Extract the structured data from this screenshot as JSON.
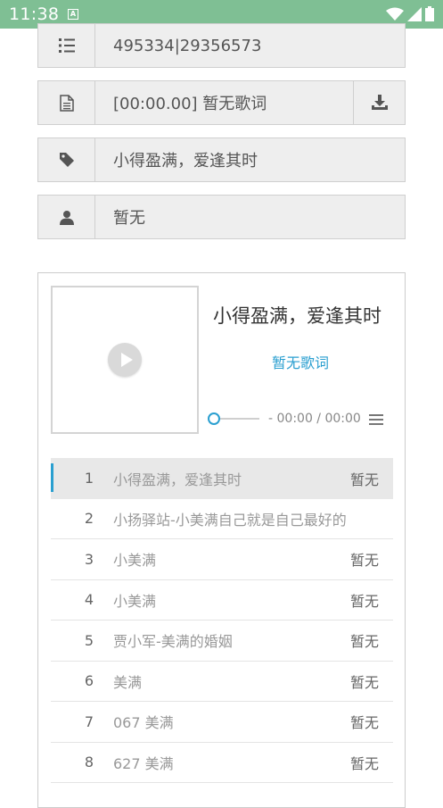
{
  "status_bar": {
    "time": "11:38",
    "badge": "A"
  },
  "info_rows": [
    {
      "icon": "list-ordered-icon",
      "value": "495334|29356573"
    },
    {
      "icon": "document-icon",
      "value": "[00:00.00] 暂无歌词",
      "action_icon": "download-icon"
    },
    {
      "icon": "tag-icon",
      "value": "小得盈满，爱逢其时"
    },
    {
      "icon": "user-icon",
      "value": "暂无"
    }
  ],
  "player": {
    "title": "小得盈满，爱逢其时",
    "lyric": "暂无歌词",
    "time": "- 00:00 / 00:00",
    "progress": 0
  },
  "playlist": [
    {
      "index": "1",
      "name": "小得盈满，爱逢其时",
      "artist": "暂无"
    },
    {
      "index": "2",
      "name": "小扬驿站-小美满自己就是自己最好的陪",
      "artist": ""
    },
    {
      "index": "3",
      "name": "小美满",
      "artist": "暂无"
    },
    {
      "index": "4",
      "name": "小美满",
      "artist": "暂无"
    },
    {
      "index": "5",
      "name": "贾小军-美满的婚姻",
      "artist": "暂无"
    },
    {
      "index": "6",
      "name": "美满",
      "artist": "暂无"
    },
    {
      "index": "7",
      "name": "067 美满",
      "artist": "暂无"
    },
    {
      "index": "8",
      "name": "627 美满",
      "artist": "暂无"
    }
  ],
  "colors": {
    "statusbar": "#7fbf94",
    "accent": "#2a9fd0"
  }
}
